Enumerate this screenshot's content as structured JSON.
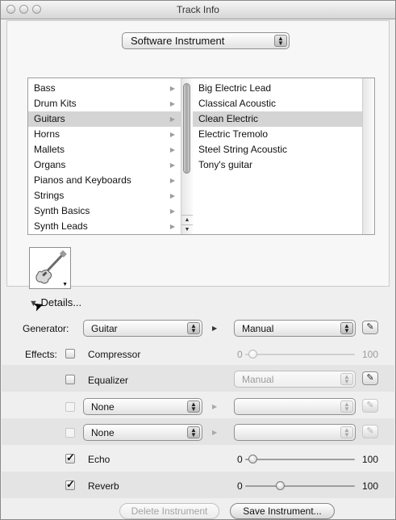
{
  "window": {
    "title": "Track Info"
  },
  "instrument_type": {
    "selected": "Software Instrument"
  },
  "categories": {
    "items": [
      "Bass",
      "Drum Kits",
      "Guitars",
      "Horns",
      "Mallets",
      "Organs",
      "Pianos and Keyboards",
      "Strings",
      "Synth Basics",
      "Synth Leads"
    ],
    "selected_index": 2
  },
  "instruments": {
    "items": [
      "Big Electric Lead",
      "Classical Acoustic",
      "Clean Electric",
      "Electric Tremolo",
      "Steel String Acoustic",
      "Tony's guitar"
    ],
    "selected_index": 2
  },
  "instrument_icon": {
    "name": "electric-guitar-icon"
  },
  "details": {
    "label": "Details..."
  },
  "generator": {
    "label": "Generator:",
    "value": "Guitar",
    "preset": "Manual"
  },
  "effects": {
    "label": "Effects:",
    "rows": [
      {
        "name": "Compressor",
        "checked": false,
        "slider_min": "0",
        "slider_max": "100",
        "level": 0.03,
        "enabled": false
      },
      {
        "name": "Equalizer",
        "checked": false,
        "preset": "Manual",
        "enabled": false
      },
      {
        "popup": "None",
        "checked": false
      },
      {
        "popup": "None",
        "checked": false
      },
      {
        "name": "Echo",
        "checked": true,
        "slider_min": "0",
        "slider_max": "100",
        "level": 0.03,
        "enabled": true
      },
      {
        "name": "Reverb",
        "checked": true,
        "slider_min": "0",
        "slider_max": "100",
        "level": 0.3,
        "enabled": true
      }
    ]
  },
  "buttons": {
    "delete": "Delete Instrument",
    "save": "Save Instrument..."
  }
}
